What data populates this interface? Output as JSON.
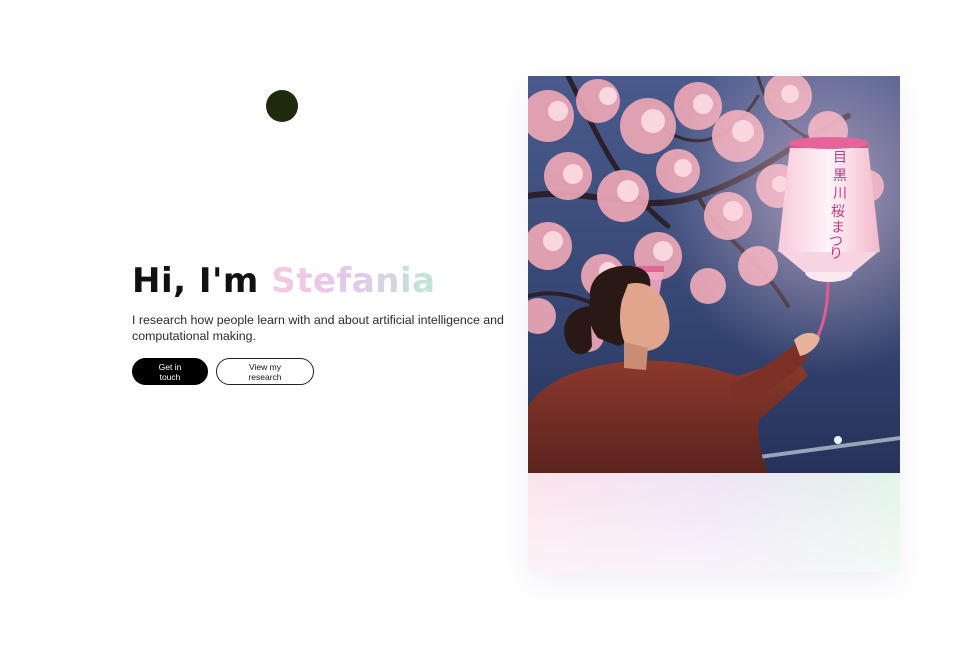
{
  "hero": {
    "greeting": "Hi, I'm",
    "name": "Stefania",
    "tagline": "I research how people learn with and about artificial intelligence and computational making.",
    "primary_button_label": "Get in touch",
    "secondary_button_label": "View my research"
  },
  "photo": {
    "lantern_characters": [
      "目",
      "黒",
      "川",
      "桜",
      "ま",
      "つ",
      "り"
    ]
  },
  "colors": {
    "dot": "#1f2a0c",
    "name_gradient": [
      "#f4cbe0",
      "#e2c7ec",
      "#bfe8d2"
    ],
    "primary_button": "#000000"
  }
}
